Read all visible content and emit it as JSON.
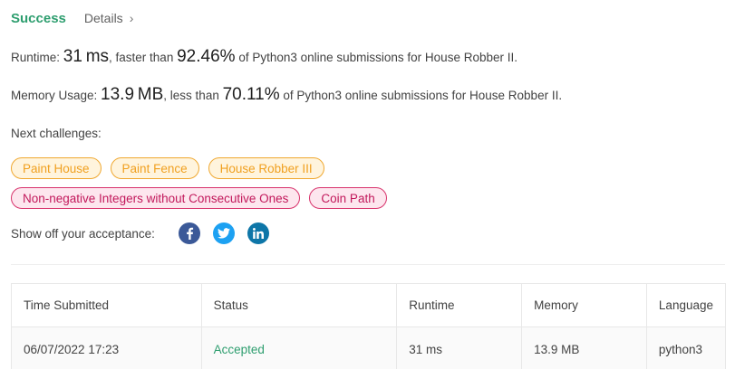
{
  "header": {
    "status": "Success",
    "details_label": "Details",
    "details_chevron": "›"
  },
  "runtime": {
    "label": "Runtime:",
    "value": "31",
    "unit": "ms",
    "comparison": ", faster than",
    "percent": "92.46%",
    "suffix": "of Python3 online submissions for House Robber II."
  },
  "memory": {
    "label": "Memory Usage:",
    "value": "13.9",
    "unit": "MB",
    "comparison": ", less than",
    "percent": "70.11%",
    "suffix": "of Python3 online submissions for House Robber II."
  },
  "next_challenges": {
    "label": "Next challenges:",
    "row1": [
      "Paint House",
      "Paint Fence",
      "House Robber III"
    ],
    "row2": [
      "Non-negative Integers without Consecutive Ones",
      "Coin Path"
    ]
  },
  "share": {
    "label": "Show off your acceptance:",
    "icons": [
      "facebook-icon",
      "twitter-icon",
      "linkedin-icon"
    ],
    "colors": {
      "facebook": "#3b5998",
      "twitter": "#1da1f2",
      "linkedin": "#0e76a8"
    }
  },
  "table": {
    "headers": [
      "Time Submitted",
      "Status",
      "Runtime",
      "Memory",
      "Language"
    ],
    "rows": [
      [
        "06/07/2022 17:23",
        "Accepted",
        "31 ms",
        "13.9 MB",
        "python3"
      ]
    ]
  },
  "colors": {
    "success": "#2e9e6f",
    "medium_tag": "#f0a020",
    "hard_tag": "#c2185b"
  }
}
